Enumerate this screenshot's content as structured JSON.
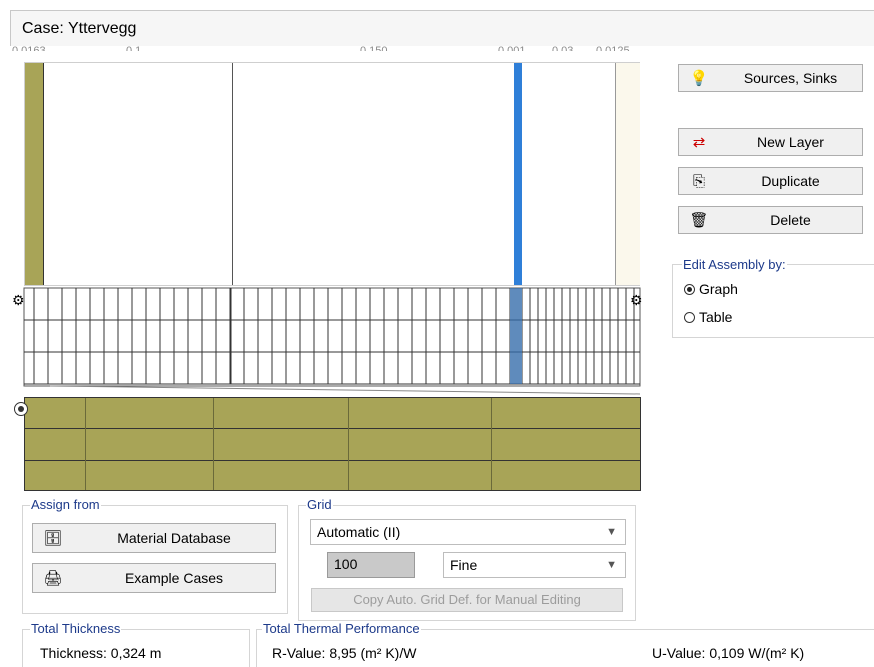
{
  "case": {
    "title": "Case:  Yttervegg"
  },
  "ruler": {
    "labels": [
      "0.0163",
      "0.1",
      "0.150",
      "0.001",
      "0.03",
      "0.0125"
    ]
  },
  "buttons": {
    "sources_sinks": "Sources, Sinks",
    "new_layer": "New Layer",
    "duplicate": "Duplicate",
    "delete": "Delete"
  },
  "edit_assembly": {
    "legend": "Edit Assembly by:",
    "options": [
      "Graph",
      "Table"
    ],
    "selected": "Graph"
  },
  "assign_from": {
    "legend": "Assign from",
    "material_database": "Material Database",
    "example_cases": "Example Cases"
  },
  "grid": {
    "legend": "Grid",
    "mode": "Automatic (II)",
    "value": "100",
    "fineness": "Fine",
    "copy_button": "Copy Auto. Grid Def. for Manual Editing"
  },
  "total_thickness": {
    "legend": "Total Thickness",
    "text": "Thickness: 0,324 m"
  },
  "thermal": {
    "legend": "Total Thermal Performance",
    "r_value": "R-Value: 8,95 (m² K)/W",
    "u_value": "U-Value: 0,109 W/(m² K)"
  },
  "colors": {
    "layer_olive": "#a8a457",
    "membrane_blue": "#2f7fd8",
    "legend_text": "#1d3a8a"
  }
}
